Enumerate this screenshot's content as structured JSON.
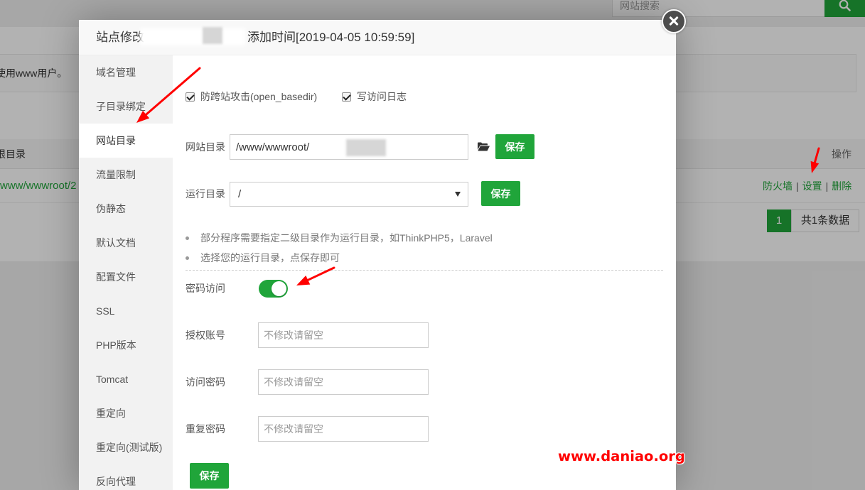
{
  "page": {
    "search": {
      "placeholder": "网站搜索"
    },
    "notice_text": "使用www用户。",
    "table": {
      "headers": {
        "root_dir": "根目录",
        "actions": "操作"
      },
      "rows": [
        {
          "root_dir": "www/wwwroot/2",
          "actions": [
            "防火墙",
            "设置",
            "删除"
          ]
        }
      ],
      "action_separator": "|"
    },
    "pagination": {
      "current_page": "1",
      "summary": "共1条数据"
    }
  },
  "modal": {
    "title": {
      "prefix": "站点修改",
      "added_time": "添加时间[2019-04-05 10:59:59]"
    },
    "sidebar": {
      "items": [
        "域名管理",
        "子目录绑定",
        "网站目录",
        "流量限制",
        "伪静态",
        "默认文档",
        "配置文件",
        "SSL",
        "PHP版本",
        "Tomcat",
        "重定向",
        "重定向(测试版)",
        "反向代理"
      ],
      "active_index": 2
    },
    "options": [
      {
        "label": "防跨站攻击(open_basedir)",
        "checked": true
      },
      {
        "label": "写访问日志",
        "checked": true
      }
    ],
    "site_dir": {
      "label": "网站目录",
      "value": "/www/wwwroot/",
      "save_label": "保存"
    },
    "run_dir": {
      "label": "运行目录",
      "selected": "/",
      "save_label": "保存"
    },
    "tips": [
      "部分程序需要指定二级目录作为运行目录，如ThinkPHP5，Laravel",
      "选择您的运行目录，点保存即可"
    ],
    "password_access": {
      "label": "密码访问",
      "enabled": true
    },
    "auth_fields": [
      {
        "label": "授权账号",
        "placeholder": "不修改请留空"
      },
      {
        "label": "访问密码",
        "placeholder": "不修改请留空"
      },
      {
        "label": "重复密码",
        "placeholder": "不修改请留空"
      }
    ],
    "save_label": "保存"
  },
  "watermark": "www.daniao.org",
  "icons": {
    "search_button": "search-icon",
    "close_button": "close-icon",
    "site_dir_browse": "folder-open-icon",
    "run_dir_dropdown": "chevron-down-icon",
    "annotations": "red-arrow-icon"
  },
  "colors": {
    "accent": "#20a53a",
    "annotation": "#ff0000",
    "watermark": "#ff0000"
  }
}
